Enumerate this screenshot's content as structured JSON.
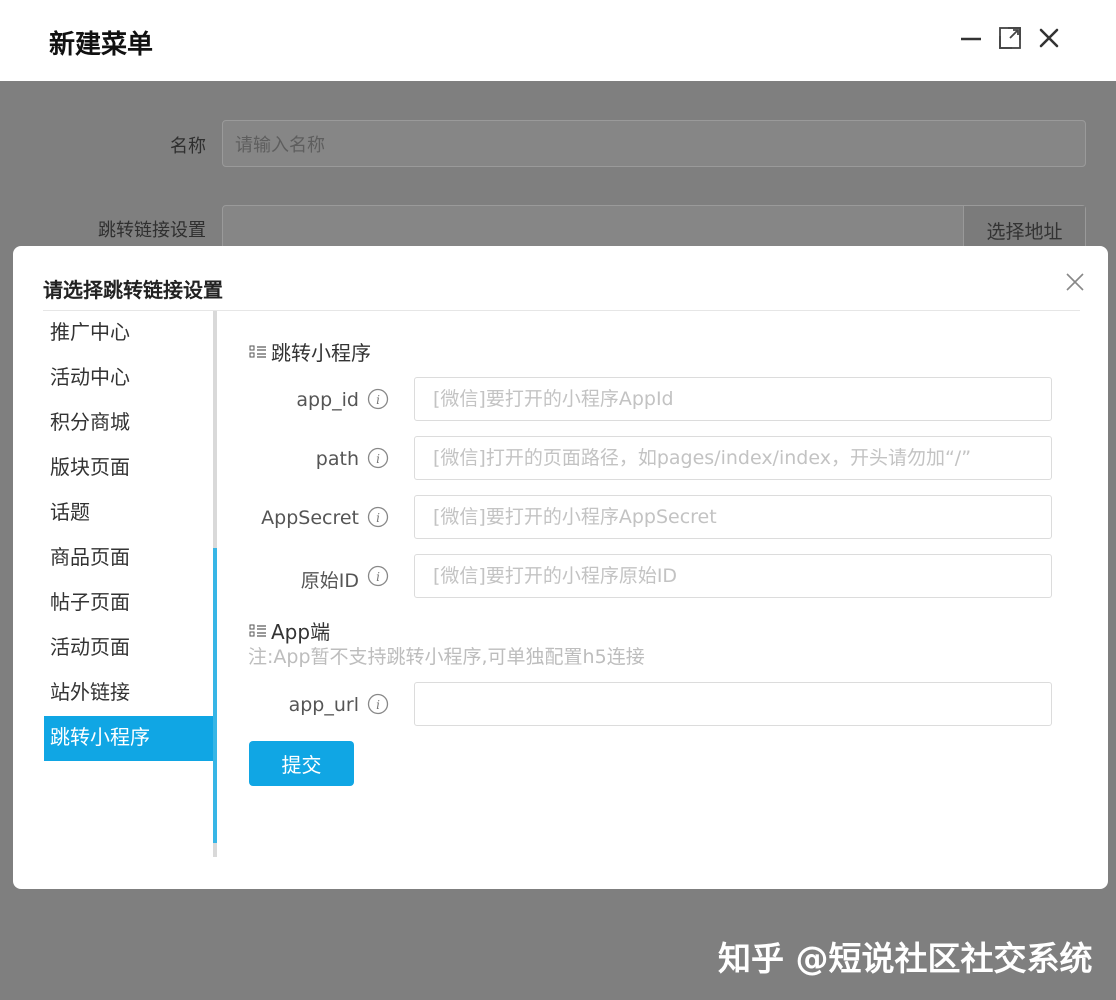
{
  "window": {
    "title": "新建菜单",
    "controls": [
      "minimize-icon",
      "maximize-icon",
      "close-icon"
    ]
  },
  "background_form": {
    "name_label": "名称",
    "name_placeholder": "请输入名称",
    "link_label": "跳转链接设置",
    "select_address_button": "选择地址"
  },
  "modal": {
    "title": "请选择跳转链接设置",
    "nav_items": [
      {
        "label": "推广中心"
      },
      {
        "label": "活动中心"
      },
      {
        "label": "积分商城"
      },
      {
        "label": "版块页面"
      },
      {
        "label": "话题"
      },
      {
        "label": "商品页面"
      },
      {
        "label": "帖子页面"
      },
      {
        "label": "活动页面"
      },
      {
        "label": "站外链接"
      },
      {
        "label": "跳转小程序",
        "active": true
      }
    ],
    "section_mini_program": "跳转小程序",
    "fields": [
      {
        "label": "app_id",
        "placeholder": "[微信]要打开的小程序AppId",
        "value": ""
      },
      {
        "label": "path",
        "placeholder": "[微信]打开的页面路径，如pages/index/index，开头请勿加“/”",
        "value": ""
      },
      {
        "label": "AppSecret",
        "placeholder": "[微信]要打开的小程序AppSecret",
        "value": ""
      },
      {
        "label": "原始ID",
        "placeholder": "[微信]要打开的小程序原始ID",
        "value": ""
      }
    ],
    "section_app": "App端",
    "app_note": "注:App暂不支持跳转小程序,可单独配置h5连接",
    "app_url": {
      "label": "app_url",
      "placeholder": "",
      "value": ""
    },
    "submit_label": "提交"
  },
  "watermark": "知乎 @短说社区社交系统",
  "colors": {
    "accent": "#10a6e4",
    "overlay": "#808080"
  }
}
